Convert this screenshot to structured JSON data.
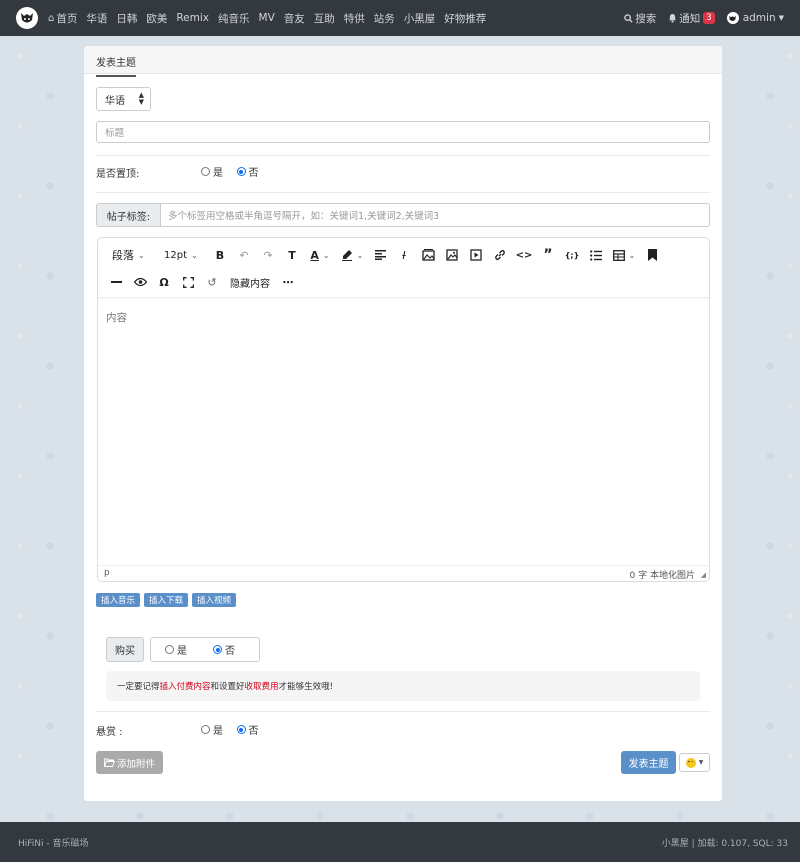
{
  "nav": {
    "items": [
      {
        "label": "首页"
      },
      {
        "label": "华语"
      },
      {
        "label": "日韩"
      },
      {
        "label": "欧美"
      },
      {
        "label": "Remix"
      },
      {
        "label": "纯音乐"
      },
      {
        "label": "MV"
      },
      {
        "label": "音友"
      },
      {
        "label": "互助"
      },
      {
        "label": "特供"
      },
      {
        "label": "站务"
      },
      {
        "label": "小黑屋"
      },
      {
        "label": "好物推荐"
      }
    ],
    "search_label": "搜索",
    "notify_label": "通知",
    "notify_count": "3",
    "user_label": "admin"
  },
  "form": {
    "tab_label": "发表主题",
    "category_value": "华语",
    "title_placeholder": "标题",
    "sticky_label": "是否置顶:",
    "yes": "是",
    "no": "否",
    "tags_label": "帖子标签:",
    "tags_placeholder": "多个标签用空格或半角逗号隔开，如：关键词1,关键词2,关键词3",
    "reward_label": "悬赏 :",
    "buy_label": "购买"
  },
  "editor": {
    "paragraph_label": "段落",
    "fontsize_label": "12pt",
    "hidden_content_label": "隐藏内容",
    "body_placeholder": "内容",
    "status_path": "p",
    "status_words": "0 字",
    "status_localize": "本地化图片"
  },
  "insert_buttons": {
    "music": "插入音乐",
    "download": "插入下载",
    "video": "插入视频"
  },
  "notice": {
    "part1": "一定要记得",
    "highlight1": "插入付费内容",
    "part2": "和设置好",
    "highlight2": "收取费用",
    "part3": "才能够生效哦!"
  },
  "actions": {
    "attach_label": "添加附件",
    "submit_label": "发表主题"
  },
  "footer": {
    "left": "HiFiNi - 音乐磁场",
    "right": "小黑屋 | 加载: 0.107, SQL: 33"
  },
  "colors": {
    "navbar": "#33393f",
    "primary_button": "#5b8fc9",
    "badge": "#dc3545",
    "highlight_red": "#d0021b"
  }
}
